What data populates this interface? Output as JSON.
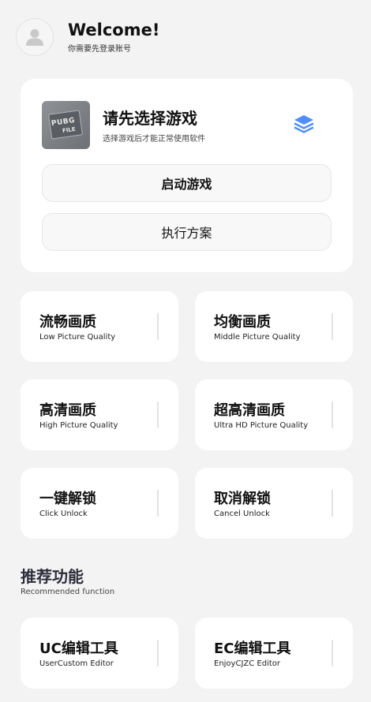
{
  "header": {
    "welcome": "Welcome!",
    "subtitle": "你需要先登录账号",
    "avatar_icon": "user-icon"
  },
  "game_card": {
    "thumb_text_1": "PUBG",
    "thumb_text_2": "FILE",
    "title": "请先选择游戏",
    "subtitle": "选择游戏后才能正常使用软件",
    "icon": "layers-icon",
    "accent_color": "#4f8ff7",
    "start_label": "启动游戏",
    "exec_label": "执行方案"
  },
  "quality_tiles": [
    {
      "title": "流畅画质",
      "subtitle": "Low Picture Quality"
    },
    {
      "title": "均衡画质",
      "subtitle": "Middle Picture Quality"
    },
    {
      "title": "高清画质",
      "subtitle": "High Picture Quality"
    },
    {
      "title": "超高清画质",
      "subtitle": "Ultra HD Picture Quality"
    },
    {
      "title": "一键解锁",
      "subtitle": "Click Unlock"
    },
    {
      "title": "取消解锁",
      "subtitle": "Cancel Unlock"
    }
  ],
  "recommended": {
    "title": "推荐功能",
    "subtitle": "Recommended function",
    "tiles": [
      {
        "title": "UC编辑工具",
        "subtitle": "UserCustom Editor"
      },
      {
        "title": "EC编辑工具",
        "subtitle": "EnjoyCJZC Editor"
      }
    ]
  }
}
